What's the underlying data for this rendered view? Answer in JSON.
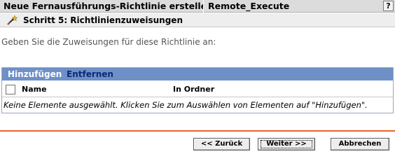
{
  "title_bar": {
    "title": "Neue Fernausführungs-Richtlinie erstellen",
    "object_name": "Remote_Execute",
    "help_label": "?"
  },
  "step": {
    "icon": "wand-icon",
    "title": "Schritt 5: Richtlinienzuweisungen"
  },
  "instruction": "Geben Sie die Zuweisungen für diese Richtlinie an:",
  "table": {
    "toolbar": {
      "add_label": "Hinzufügen",
      "remove_label": "Entfernen"
    },
    "columns": [
      "Name",
      "In Ordner"
    ],
    "select_all_checked": false,
    "rows": [],
    "empty_message": "Keine Elemente ausgewählt. Klicken Sie zum Auswählen von Elementen auf \"Hinzufügen\"."
  },
  "colors": {
    "title_bar_bg": "#dcdcdc",
    "toolbar_bg": "#6f8fc7",
    "divider": "#e8642c"
  },
  "buttons": {
    "back": "<< Zurück",
    "next": "Weiter >>",
    "cancel": "Abbrechen"
  }
}
